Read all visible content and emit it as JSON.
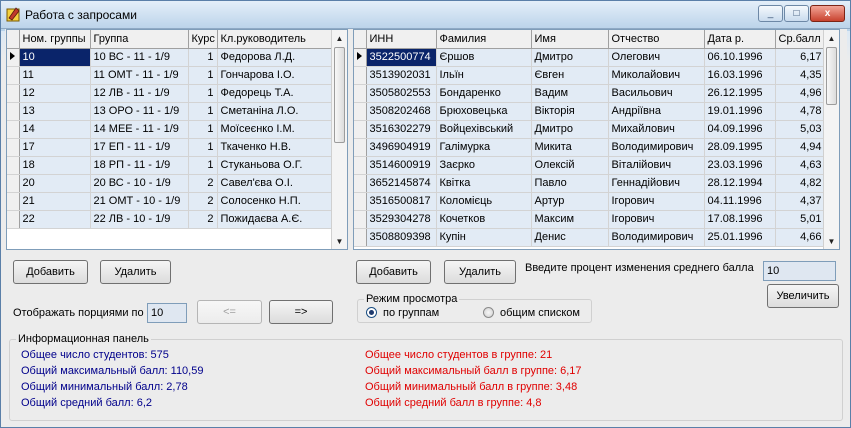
{
  "window": {
    "title": "Работа с запросами",
    "minimize": "_",
    "maximize": "□",
    "close": "x"
  },
  "groups_grid": {
    "columns": [
      "Ном. группы",
      "Группа",
      "Курс",
      "Кл.руководитель"
    ],
    "rows": [
      [
        "10",
        "10 ВС - 11 - 1/9",
        "1",
        "Федорова Л.Д."
      ],
      [
        "11",
        "11 ОМТ - 11 - 1/9",
        "1",
        "Гончарова І.О."
      ],
      [
        "12",
        "12 ЛВ - 11 - 1/9",
        "1",
        "Федорець Т.А."
      ],
      [
        "13",
        "13 ОРО - 11 - 1/9",
        "1",
        "Сметаніна Л.О."
      ],
      [
        "14",
        "14 МЕЕ - 11 - 1/9",
        "1",
        "Моїсеєнко І.М."
      ],
      [
        "17",
        "17 ЕП - 11 - 1/9",
        "1",
        "Ткаченко Н.В."
      ],
      [
        "18",
        "18 РП - 11 - 1/9",
        "1",
        "Стуканьова О.Г."
      ],
      [
        "20",
        "20 ВС - 10 - 1/9",
        "2",
        "Савел'єва О.І."
      ],
      [
        "21",
        "21 ОМТ - 10 - 1/9",
        "2",
        "Солосенко Н.П."
      ],
      [
        "22",
        "22 ЛВ - 10 - 1/9",
        "2",
        "Пожидаєва А.Є."
      ]
    ]
  },
  "students_grid": {
    "columns": [
      "ИНН",
      "Фамилия",
      "Имя",
      "Отчество",
      "Дата р.",
      "Ср.балл"
    ],
    "rows": [
      [
        "3522500774",
        "Єршов",
        "Дмитро",
        "Олегович",
        "06.10.1996",
        "6,17"
      ],
      [
        "3513902031",
        "Ільїн",
        "Євген",
        "Миколайович",
        "16.03.1996",
        "4,35"
      ],
      [
        "3505802553",
        "Бондаренко",
        "Вадим",
        "Васильович",
        "26.12.1995",
        "4,96"
      ],
      [
        "3508202468",
        "Брюховецька",
        "Вікторія",
        "Андріївна",
        "19.01.1996",
        "4,78"
      ],
      [
        "3516302279",
        "Войцехівський",
        "Дмитро",
        "Михайлович",
        "04.09.1996",
        "5,03"
      ],
      [
        "3496904919",
        "Галімурка",
        "Микита",
        "Володимирович",
        "28.09.1995",
        "4,94"
      ],
      [
        "3514600919",
        "Заєрко",
        "Олексій",
        "Віталійович",
        "23.03.1996",
        "4,63"
      ],
      [
        "3652145874",
        "Квітка",
        "Павло",
        "Геннадійович",
        "28.12.1994",
        "4,82"
      ],
      [
        "3516500817",
        "Коломієць",
        "Артур",
        "Ігорович",
        "04.11.1996",
        "4,37"
      ],
      [
        "3529304278",
        "Кочетков",
        "Максим",
        "Ігорович",
        "17.08.1996",
        "5,01"
      ],
      [
        "3508809398",
        "Купін",
        "Денис",
        "Володимирович",
        "25.01.1996",
        "4,66"
      ]
    ]
  },
  "left_buttons": {
    "add": "Добавить",
    "delete": "Удалить"
  },
  "right_buttons": {
    "add": "Добавить",
    "delete": "Удалить"
  },
  "percent": {
    "label": "Введите процент изменения среднего балла",
    "value": "10",
    "increase": "Увеличить"
  },
  "paging": {
    "label": "Отображать порциями по",
    "value": "10",
    "prev": "<=",
    "next": "=>"
  },
  "view_mode": {
    "caption": "Режим просмотра",
    "by_groups": "по группам",
    "all_list": "общим списком",
    "selected": "by_groups"
  },
  "info": {
    "caption": "Информационная панель",
    "total_students": "Общее число студентов: 575",
    "max_score": "Общий максимальный балл: 110,59",
    "min_score": "Общий минимальный балл: 2,78",
    "avg_score": "Общий средний балл: 6,2",
    "group_students": "Общее число студентов в группе: 21",
    "group_max": "Общий максимальный балл в группе: 6,17",
    "group_min": "Общий минимальный балл в группе: 3,48",
    "group_avg": "Общий средний балл в группе: 4,8"
  },
  "colors": {
    "info_left": "#00008b",
    "info_right": "#e00000",
    "selection": "#0a246a"
  }
}
